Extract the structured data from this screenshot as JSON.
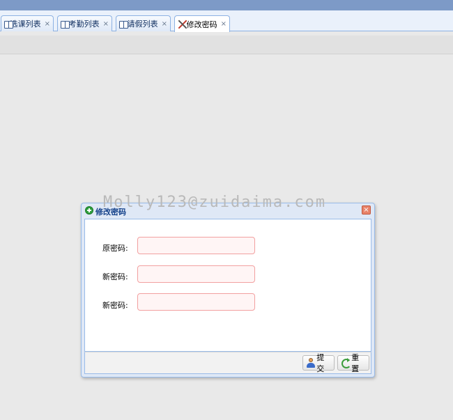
{
  "tabs": [
    {
      "label": "选课列表",
      "close": "×",
      "icon": "book-icon"
    },
    {
      "label": "考勤列表",
      "close": "×",
      "icon": "book-icon"
    },
    {
      "label": "请假列表",
      "close": "×",
      "icon": "book-icon"
    },
    {
      "label": "修改密码",
      "close": "×",
      "icon": "tools-icon",
      "active": true
    }
  ],
  "watermark": "Molly123@zuidaima.com",
  "dialog": {
    "title": "修改密码",
    "close": "×",
    "fields": [
      {
        "label": "原密码:",
        "value": ""
      },
      {
        "label": "新密码:",
        "value": ""
      },
      {
        "label": "新密码:",
        "value": ""
      }
    ],
    "buttons": {
      "submit": "提交",
      "reset": "重置"
    }
  },
  "colors": {
    "topbar": "#7d9ac7",
    "tab_border": "#8db2e3",
    "dialog_title": "#15428b",
    "field_border": "#f2a0a0"
  }
}
